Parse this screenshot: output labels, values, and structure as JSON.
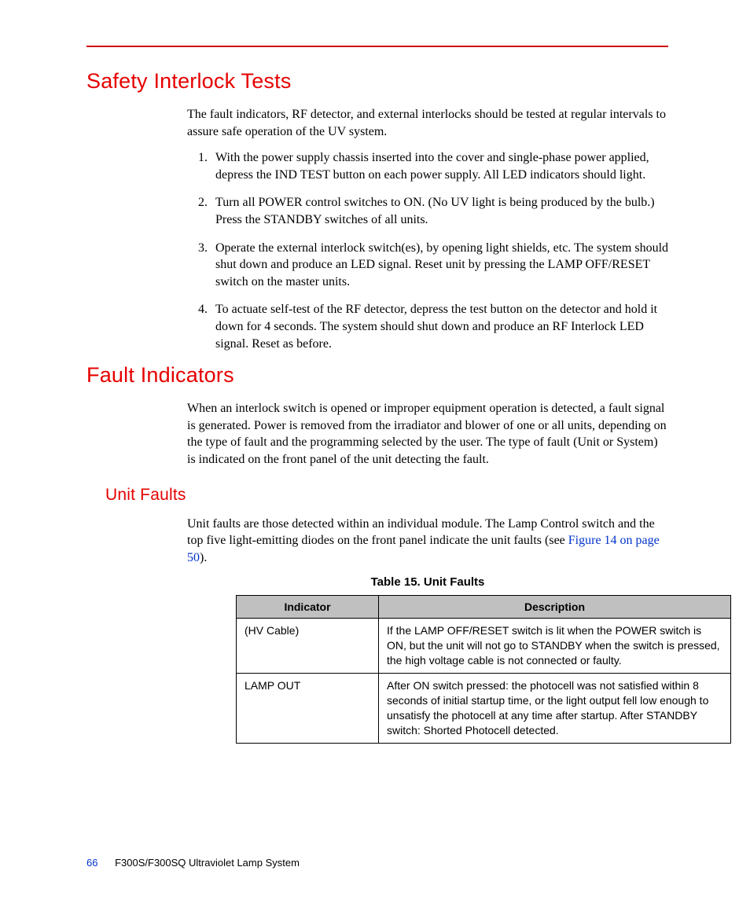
{
  "heading1": "Safety Interlock Tests",
  "intro1": "The fault indicators, RF detector, and external interlocks should be tested at regular intervals to assure safe operation of the UV system.",
  "steps": [
    "With the power supply chassis inserted into the cover and single-phase power applied, depress the IND TEST button on each power supply. All LED indicators should light.",
    "Turn all POWER control switches to ON. (No UV light is being produced by the bulb.) Press the STANDBY switches of all units.",
    "Operate the external interlock switch(es), by opening light shields, etc. The system should shut down and produce an LED signal. Reset unit by pressing the LAMP OFF/RESET switch on the master units.",
    "To actuate self-test of the RF detector, depress the test button on the detector and hold it down for 4 seconds. The system should shut down and produce an RF Interlock LED signal. Reset as before."
  ],
  "heading2": "Fault Indicators",
  "intro2": "When an interlock switch is opened or improper equipment operation is detected, a fault signal is generated. Power is removed from the irradiator and blower of one or all units, depending on the type of fault and the programming selected by the user. The type of fault (Unit or System) is indicated on the front panel of the unit detecting the fault.",
  "heading3": "Unit Faults",
  "intro3a": "Unit faults are those detected within an individual module. The Lamp Control switch and the top five light-emitting diodes on the front panel indicate the unit faults (see ",
  "intro3link": "Figure 14 on page 50",
  "intro3b": ").",
  "tableCaption": "Table 15. Unit Faults",
  "table": {
    "headers": [
      "Indicator",
      "Description"
    ],
    "rows": [
      {
        "indicator": "(HV Cable)",
        "description": "If the LAMP OFF/RESET switch is lit when the POWER switch is ON, but the unit will not go to STANDBY when the switch is pressed, the high voltage cable is not connected or faulty."
      },
      {
        "indicator": "LAMP OUT",
        "description": "After ON switch pressed: the photocell was not satisfied within 8 seconds of initial startup time, or the light output fell low enough to unsatisfy the photocell at any time after startup. After STANDBY switch: Shorted Photocell detected."
      }
    ]
  },
  "footer": {
    "page": "66",
    "title": "F300S/F300SQ Ultraviolet Lamp System"
  }
}
